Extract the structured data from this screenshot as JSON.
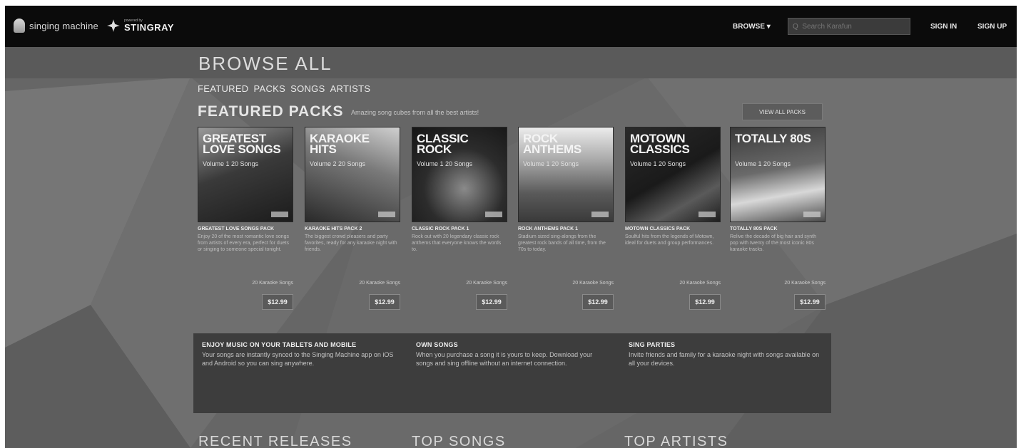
{
  "header": {
    "brand": "singing machine",
    "partner_tagline": "powered by",
    "partner": "STINGRAY",
    "browse_label": "BROWSE ▾",
    "search_placeholder": "Q  Search Karafun",
    "signin_label": "SIGN IN",
    "signup_label": "SIGN UP"
  },
  "page": {
    "title": "BROWSE ALL",
    "tabs": [
      "FEATURED",
      "PACKS",
      "SONGS",
      "ARTISTS"
    ]
  },
  "featured": {
    "heading": "FEATURED PACKS",
    "subtitle": "Amazing song cubes from all the best artists!",
    "view_all_label": "VIEW ALL PACKS",
    "packs": [
      {
        "cover_title": "Greatest Love Songs",
        "cover_sub": "Volume 1 20 Songs",
        "name": "GREATEST LOVE SONGS PACK",
        "desc": "Enjoy 20 of the most romantic love songs from artists of every era, perfect for duets or singing to someone special tonight.",
        "count": "20 Karaoke Songs",
        "price": "$12.99"
      },
      {
        "cover_title": "Karaoke Hits",
        "cover_sub": "Volume 2 20 Songs",
        "name": "KARAOKE HITS PACK 2",
        "desc": "The biggest crowd pleasers and party favorites, ready for any karaoke night with friends.",
        "count": "20 Karaoke Songs",
        "price": "$12.99"
      },
      {
        "cover_title": "Classic Rock",
        "cover_sub": "Volume 1 20 Songs",
        "name": "CLASSIC ROCK PACK 1",
        "desc": "Rock out with 20 legendary classic rock anthems that everyone knows the words to.",
        "count": "20 Karaoke Songs",
        "price": "$12.99"
      },
      {
        "cover_title": "Rock Anthems",
        "cover_sub": "Volume 1 20 Songs",
        "name": "ROCK ANTHEMS PACK 1",
        "desc": "Stadium sized sing-alongs from the greatest rock bands of all time, from the 70s to today.",
        "count": "20 Karaoke Songs",
        "price": "$12.99"
      },
      {
        "cover_title": "Motown Classics",
        "cover_sub": "Volume 1 20 Songs",
        "name": "MOTOWN CLASSICS PACK",
        "desc": "Soulful hits from the legends of Motown, ideal for duets and group performances.",
        "count": "20 Karaoke Songs",
        "price": "$12.99"
      },
      {
        "cover_title": "Totally 80s",
        "cover_sub": "Volume 1 20 Songs",
        "name": "TOTALLY 80S PACK",
        "desc": "Relive the decade of big hair and synth pop with twenty of the most iconic 80s karaoke tracks.",
        "count": "20 Karaoke Songs",
        "price": "$12.99"
      }
    ]
  },
  "info": [
    {
      "heading": "ENJOY MUSIC ON YOUR TABLETS AND MOBILE",
      "text": "Your songs are instantly synced to the Singing Machine app on iOS and Android so you can sing anywhere."
    },
    {
      "heading": "OWN SONGS",
      "text": "When you purchase a song it is yours to keep. Download your songs and sing offline without an internet connection."
    },
    {
      "heading": "SING PARTIES",
      "text": "Invite friends and family for a karaoke night with songs available on all your devices."
    }
  ],
  "sections": [
    "RECENT RELEASES",
    "TOP SONGS",
    "TOP ARTISTS"
  ]
}
